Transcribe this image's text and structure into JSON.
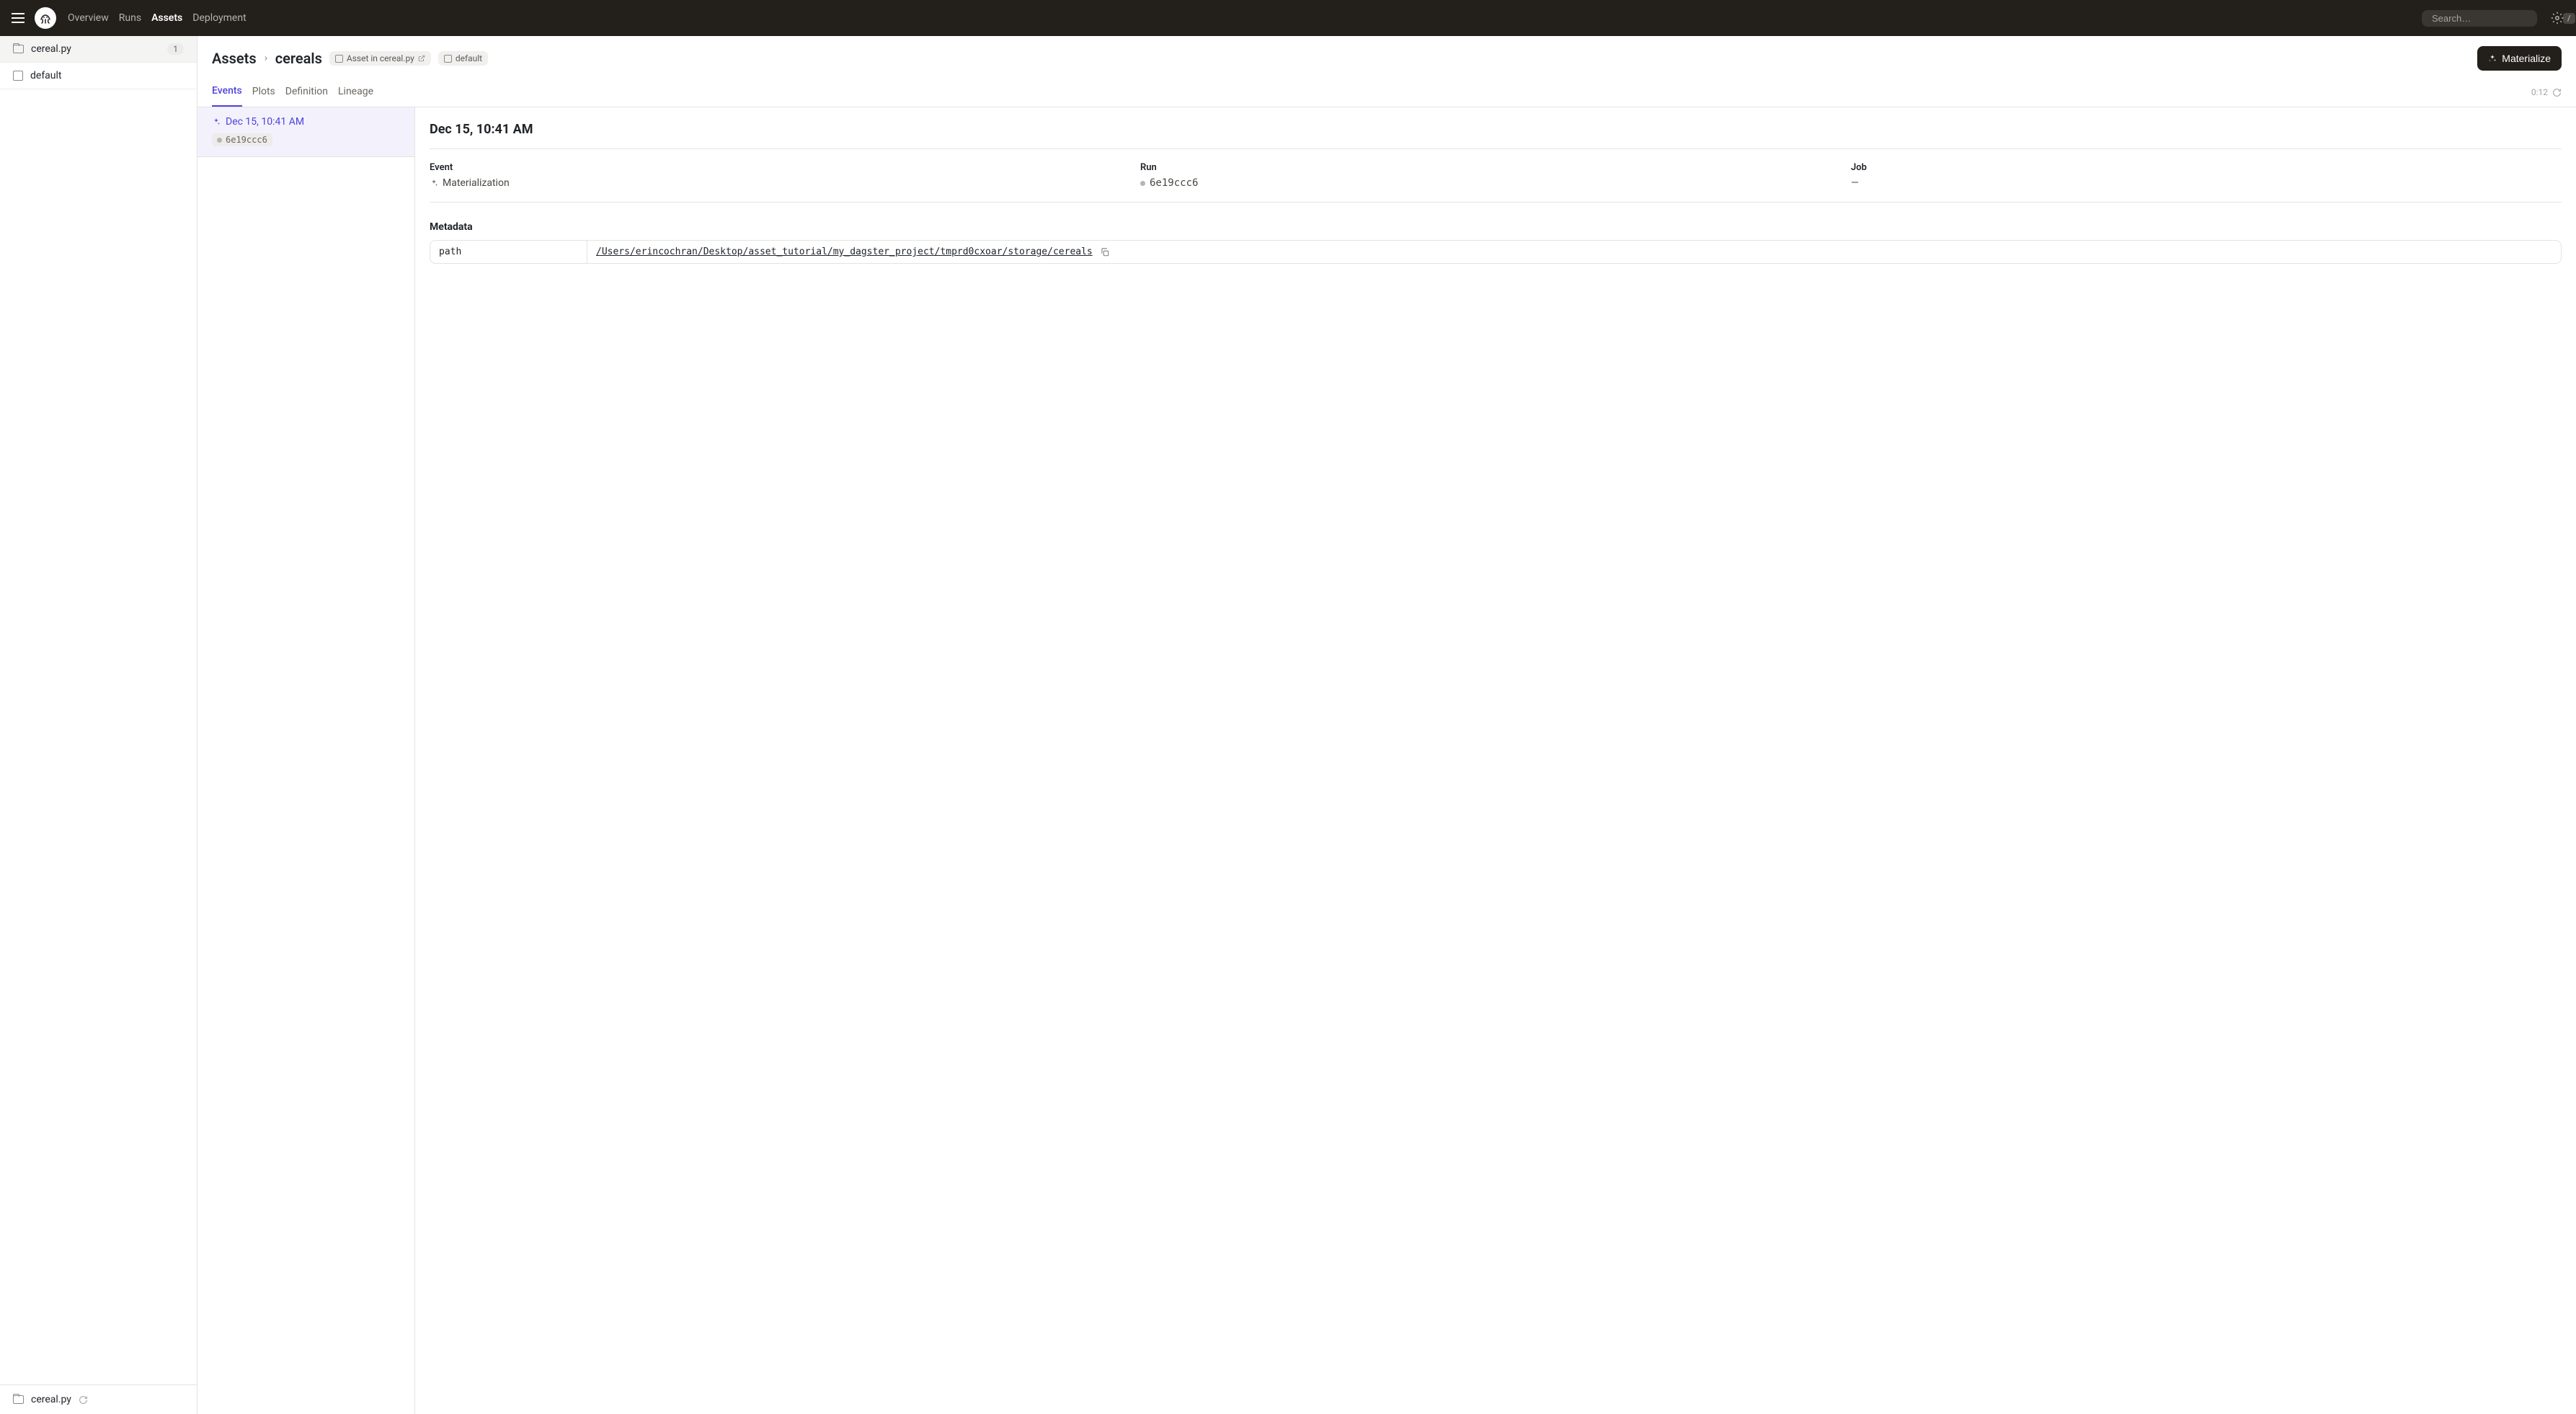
{
  "nav": {
    "overview": "Overview",
    "runs": "Runs",
    "assets": "Assets",
    "deployment": "Deployment",
    "search_placeholder": "Search…",
    "search_shortcut": "/"
  },
  "sidebar": {
    "items": [
      {
        "label": "cereal.py",
        "count": "1"
      },
      {
        "label": "default"
      }
    ],
    "footer": {
      "label": "cereal.py"
    }
  },
  "breadcrumb": {
    "root": "Assets",
    "asset": "cereals"
  },
  "tags": {
    "asset_location": "Asset in cereal.py",
    "group": "default"
  },
  "materialize_label": "Materialize",
  "tabs": {
    "events": "Events",
    "plots": "Plots",
    "definition": "Definition",
    "lineage": "Lineage"
  },
  "refresh_timer": "0:12",
  "event_list": [
    {
      "timestamp": "Dec 15, 10:41 AM",
      "run_id": "6e19ccc6"
    }
  ],
  "details": {
    "title": "Dec 15, 10:41 AM",
    "event_label": "Event",
    "event_value": "Materialization",
    "run_label": "Run",
    "run_value": "6e19ccc6",
    "job_label": "Job",
    "job_value": "—",
    "metadata_heading": "Metadata",
    "metadata": [
      {
        "key": "path",
        "value": "/Users/erincochran/Desktop/asset_tutorial/my_dagster_project/tmprd0cxoar/storage/cereals"
      }
    ]
  }
}
